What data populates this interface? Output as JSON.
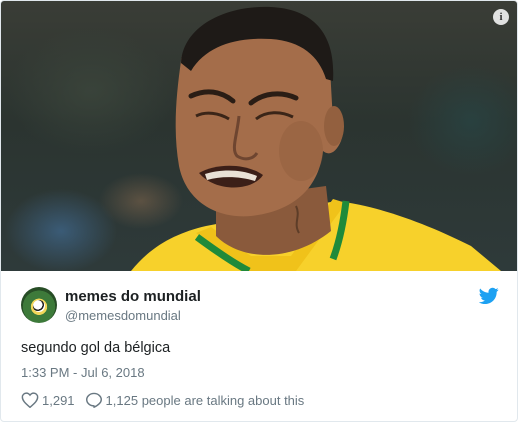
{
  "photo": {
    "alt_icon": "info-icon",
    "info_glyph": "i"
  },
  "tweet": {
    "display_name": "memes do mundial",
    "handle": "@memesdomundial",
    "text": "segundo gol da bélgica",
    "timestamp": "1:33 PM - Jul 6, 2018",
    "likes": "1,291",
    "replies_text": "1,125 people are talking about this",
    "brand_icon": "twitter-bird-icon",
    "colors": {
      "twitter_blue": "#1da1f2",
      "secondary_text": "#697882",
      "primary_text": "#1c2022",
      "jersey_yellow": "#f7d12b",
      "jersey_green": "#1f8a3a"
    }
  }
}
